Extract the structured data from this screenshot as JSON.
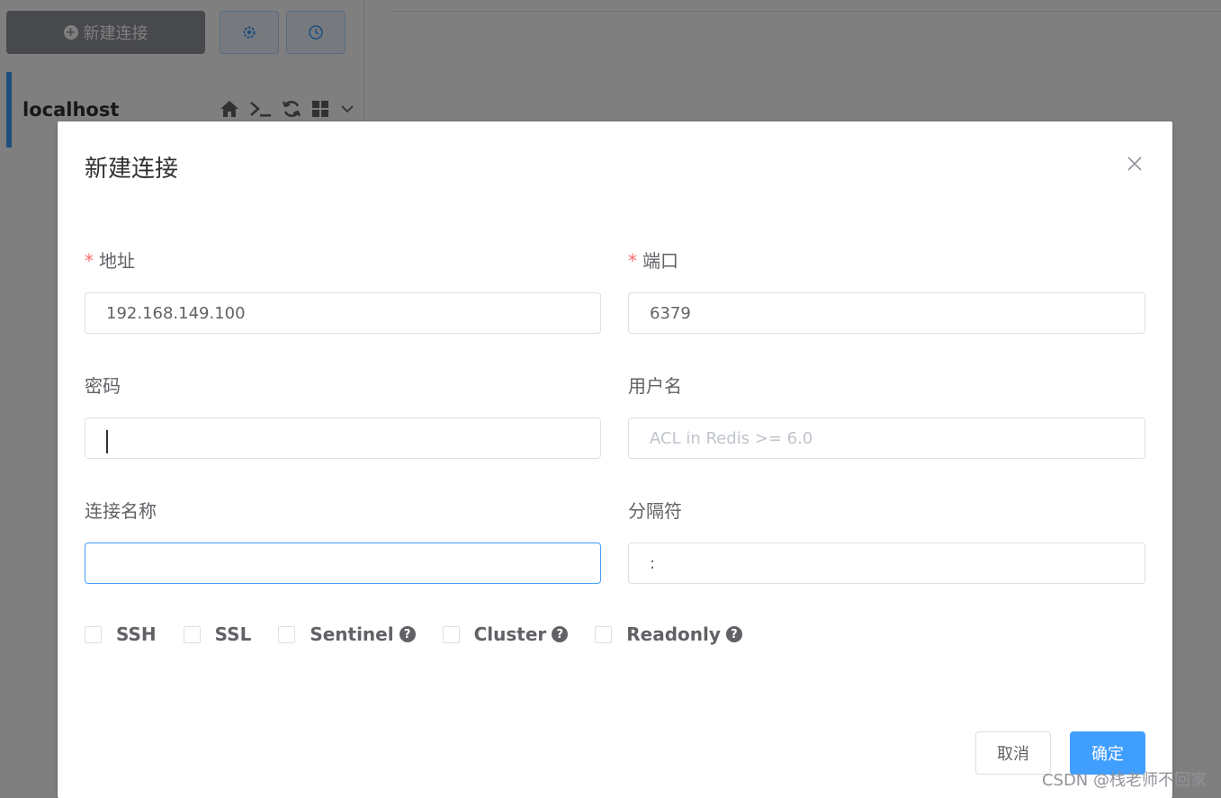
{
  "sidebar": {
    "new_connection_label": "新建连接",
    "connection_name": "localhost"
  },
  "dialog": {
    "title": "新建连接",
    "fields": {
      "address": {
        "label": "地址",
        "required": "*",
        "value": "192.168.149.100",
        "placeholder": ""
      },
      "port": {
        "label": "端口",
        "required": "*",
        "value": "6379",
        "placeholder": ""
      },
      "password": {
        "label": "密码",
        "value": "",
        "placeholder": ""
      },
      "username": {
        "label": "用户名",
        "value": "",
        "placeholder": "ACL in Redis >= 6.0"
      },
      "connection_name": {
        "label": "连接名称",
        "value": "",
        "placeholder": ""
      },
      "separator": {
        "label": "分隔符",
        "value": ":",
        "placeholder": ""
      }
    },
    "options": [
      "SSH",
      "SSL",
      "Sentinel",
      "Cluster",
      "Readonly"
    ],
    "help_mark": "?",
    "cancel_label": "取消",
    "confirm_label": "确定"
  },
  "watermark": "CSDN @栈老师不回家",
  "colors": {
    "primary": "#409eff",
    "required": "#f56c6c",
    "new_button": "#909399"
  }
}
